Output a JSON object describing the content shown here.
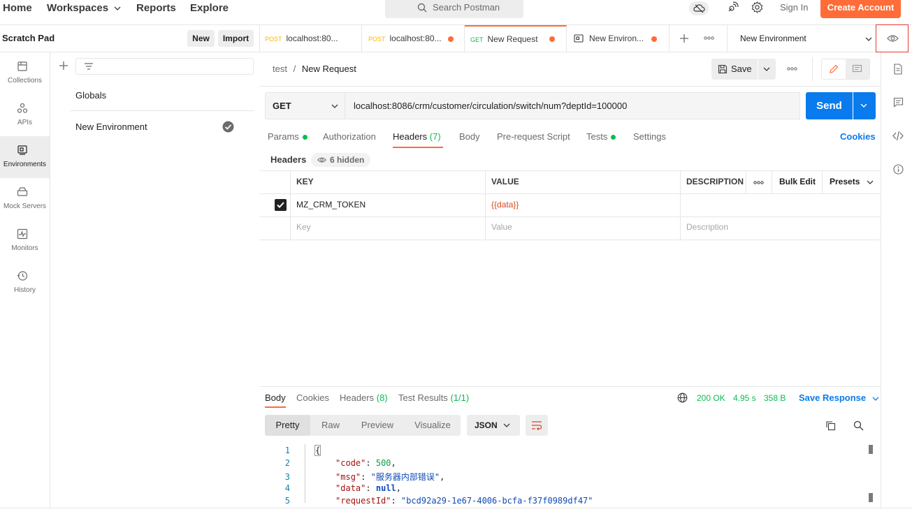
{
  "topnav": {
    "home": "Home",
    "workspaces": "Workspaces",
    "reports": "Reports",
    "explore": "Explore"
  },
  "search": {
    "placeholder": "Search Postman"
  },
  "account": {
    "signin": "Sign In",
    "create": "Create Account"
  },
  "scratch": {
    "title": "Scratch Pad",
    "new": "New",
    "import": "Import"
  },
  "rail": [
    {
      "label": "Collections",
      "icon": "collections-icon"
    },
    {
      "label": "APIs",
      "icon": "apis-icon"
    },
    {
      "label": "Environments",
      "icon": "environments-icon"
    },
    {
      "label": "Mock Servers",
      "icon": "mock-servers-icon"
    },
    {
      "label": "Monitors",
      "icon": "monitors-icon"
    },
    {
      "label": "History",
      "icon": "history-icon"
    }
  ],
  "environments": {
    "globals": "Globals",
    "items": [
      {
        "name": "New Environment",
        "active": true
      }
    ]
  },
  "tabs": [
    {
      "method": "POST",
      "title": "localhost:80...",
      "unsaved": false
    },
    {
      "method": "POST",
      "title": "localhost:80...",
      "unsaved": true
    },
    {
      "method": "GET",
      "title": "New Request",
      "unsaved": true
    },
    {
      "method": "",
      "title": "New Environ...",
      "unsaved": true
    }
  ],
  "env_select": {
    "value": "New Environment"
  },
  "request": {
    "breadcrumb_parent": "test",
    "breadcrumb_sep": "/",
    "breadcrumb_current": "New Request",
    "save": "Save",
    "method": "GET",
    "url": "localhost:8086/crm/customer/circulation/switch/num?deptId=100000",
    "send": "Send"
  },
  "req_tabs": {
    "params": "Params",
    "authorization": "Authorization",
    "headers": "Headers",
    "headers_count": "(7)",
    "body": "Body",
    "prerequest": "Pre-request Script",
    "tests": "Tests",
    "settings": "Settings",
    "cookies": "Cookies"
  },
  "headers_section": {
    "label": "Headers",
    "hidden": "6 hidden"
  },
  "headers_table": {
    "columns": {
      "key": "KEY",
      "value": "VALUE",
      "description": "DESCRIPTION"
    },
    "bulk_edit": "Bulk Edit",
    "presets": "Presets",
    "rows": [
      {
        "checked": true,
        "key": "MZ_CRM_TOKEN",
        "value": "{{data}}",
        "description": ""
      }
    ],
    "placeholders": {
      "key": "Key",
      "value": "Value",
      "description": "Description"
    }
  },
  "response": {
    "tabs": {
      "body": "Body",
      "cookies": "Cookies",
      "headers": "Headers",
      "headers_count": "(8)",
      "tests": "Test Results",
      "tests_count": "(1/1)"
    },
    "status": "200 OK",
    "time": "4.95 s",
    "size": "358 B",
    "save": "Save Response",
    "views": {
      "pretty": "Pretty",
      "raw": "Raw",
      "preview": "Preview",
      "visualize": "Visualize"
    },
    "format": "JSON",
    "code": {
      "l1": "{",
      "l2_key": "\"code\"",
      "l2_val": "500",
      "l3_key": "\"msg\"",
      "l3_val": "\"服务器内部错误\"",
      "l4_key": "\"data\"",
      "l4_val": "null",
      "l5_key": "\"requestId\"",
      "l5_val": "\"bcd92a29-1e67-4006-bcfa-f37f0989df47\""
    },
    "line_numbers": [
      "1",
      "2",
      "3",
      "4",
      "5"
    ]
  },
  "colors": {
    "accent": "#ff6c37",
    "primary": "#097bed",
    "success": "#0cbb52"
  }
}
